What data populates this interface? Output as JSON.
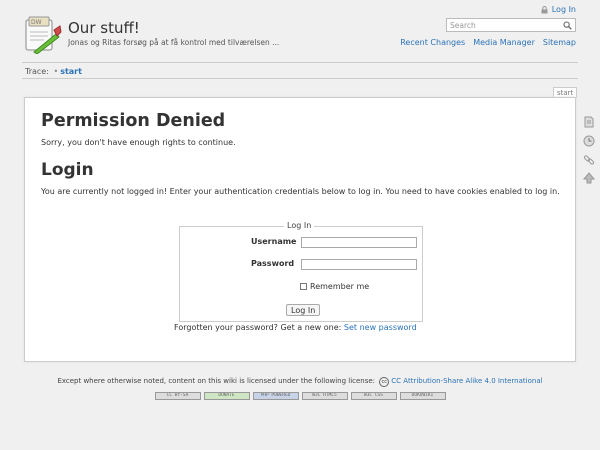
{
  "header": {
    "site_title": "Our stuff!",
    "tagline": "Jonas og Ritas forsøg på at få kontrol med tilværelsen ...",
    "logo_text": "DW"
  },
  "user_tools": {
    "login": "Log In"
  },
  "search": {
    "placeholder": "Search"
  },
  "site_tools": {
    "recent_changes": "Recent Changes",
    "media_manager": "Media Manager",
    "sitemap": "Sitemap"
  },
  "breadcrumb": {
    "label": "Trace:",
    "separator": "•",
    "page": "start"
  },
  "page_tab": "start",
  "content": {
    "title": "Permission Denied",
    "denied_message": "Sorry, you don't have enough rights to continue.",
    "login_heading": "Login",
    "login_intro": "You are currently not logged in! Enter your authentication credentials below to log in. You need to have cookies enabled to log in."
  },
  "login_form": {
    "legend": "Log In",
    "username_label": "Username",
    "password_label": "Password",
    "remember_label": "Remember me",
    "submit_label": "Log In"
  },
  "forgot": {
    "text": "Forgotten your password? Get a new one:",
    "link": "Set new password"
  },
  "footer": {
    "license_text": "Except where otherwise noted, content on this wiki is licensed under the following license:",
    "license_link": "CC Attribution-Share Alike 4.0 International",
    "badges": [
      "CC BY-SA",
      "DONATE",
      "PHP POWERED",
      "W3C HTML5",
      "W3C CSS",
      "DOKUWIKI"
    ]
  },
  "colors": {
    "link": "#2b73b7",
    "background": "#f0f0f0",
    "panel": "#ffffff",
    "border": "#cccccc"
  }
}
